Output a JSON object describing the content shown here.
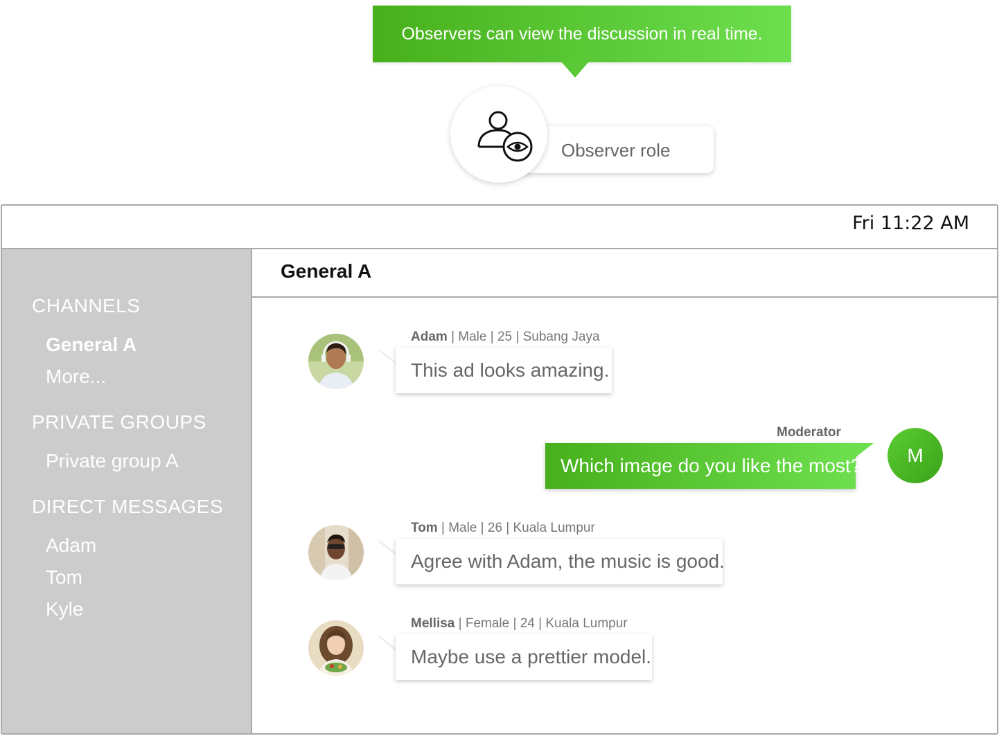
{
  "callout": {
    "tooltip": "Observers can view the discussion in real time.",
    "role_label": "Observer role",
    "role_icon": "observer-eye-icon"
  },
  "window": {
    "clock": "Fri 11:22 AM"
  },
  "sidebar": {
    "channels_heading": "CHANNELS",
    "channels": [
      "General A",
      "More..."
    ],
    "private_heading": "PRIVATE GROUPS",
    "private_groups": [
      "Private group A"
    ],
    "dm_heading": "DIRECT MESSAGES",
    "direct_messages": [
      "Adam",
      "Tom",
      "Kyle"
    ]
  },
  "main": {
    "channel_title": "General A",
    "messages": [
      {
        "author": "Adam",
        "details": " | Male | 25 | Subang Jaya",
        "text": "This ad looks amazing."
      },
      {
        "author": "Moderator",
        "avatar_letter": "M",
        "text": "Which image do you like the most?"
      },
      {
        "author": "Tom",
        "details": " | Male | 26 | Kuala Lumpur",
        "text": "Agree with Adam, the music is good."
      },
      {
        "author": "Mellisa",
        "details": " | Female | 24 | Kuala Lumpur",
        "text": "Maybe use a prettier model."
      }
    ]
  },
  "colors": {
    "accent_green_start": "#47b01c",
    "accent_green_end": "#6ddf4e",
    "sidebar_bg": "#cccccc",
    "border": "#a8a8a8"
  }
}
